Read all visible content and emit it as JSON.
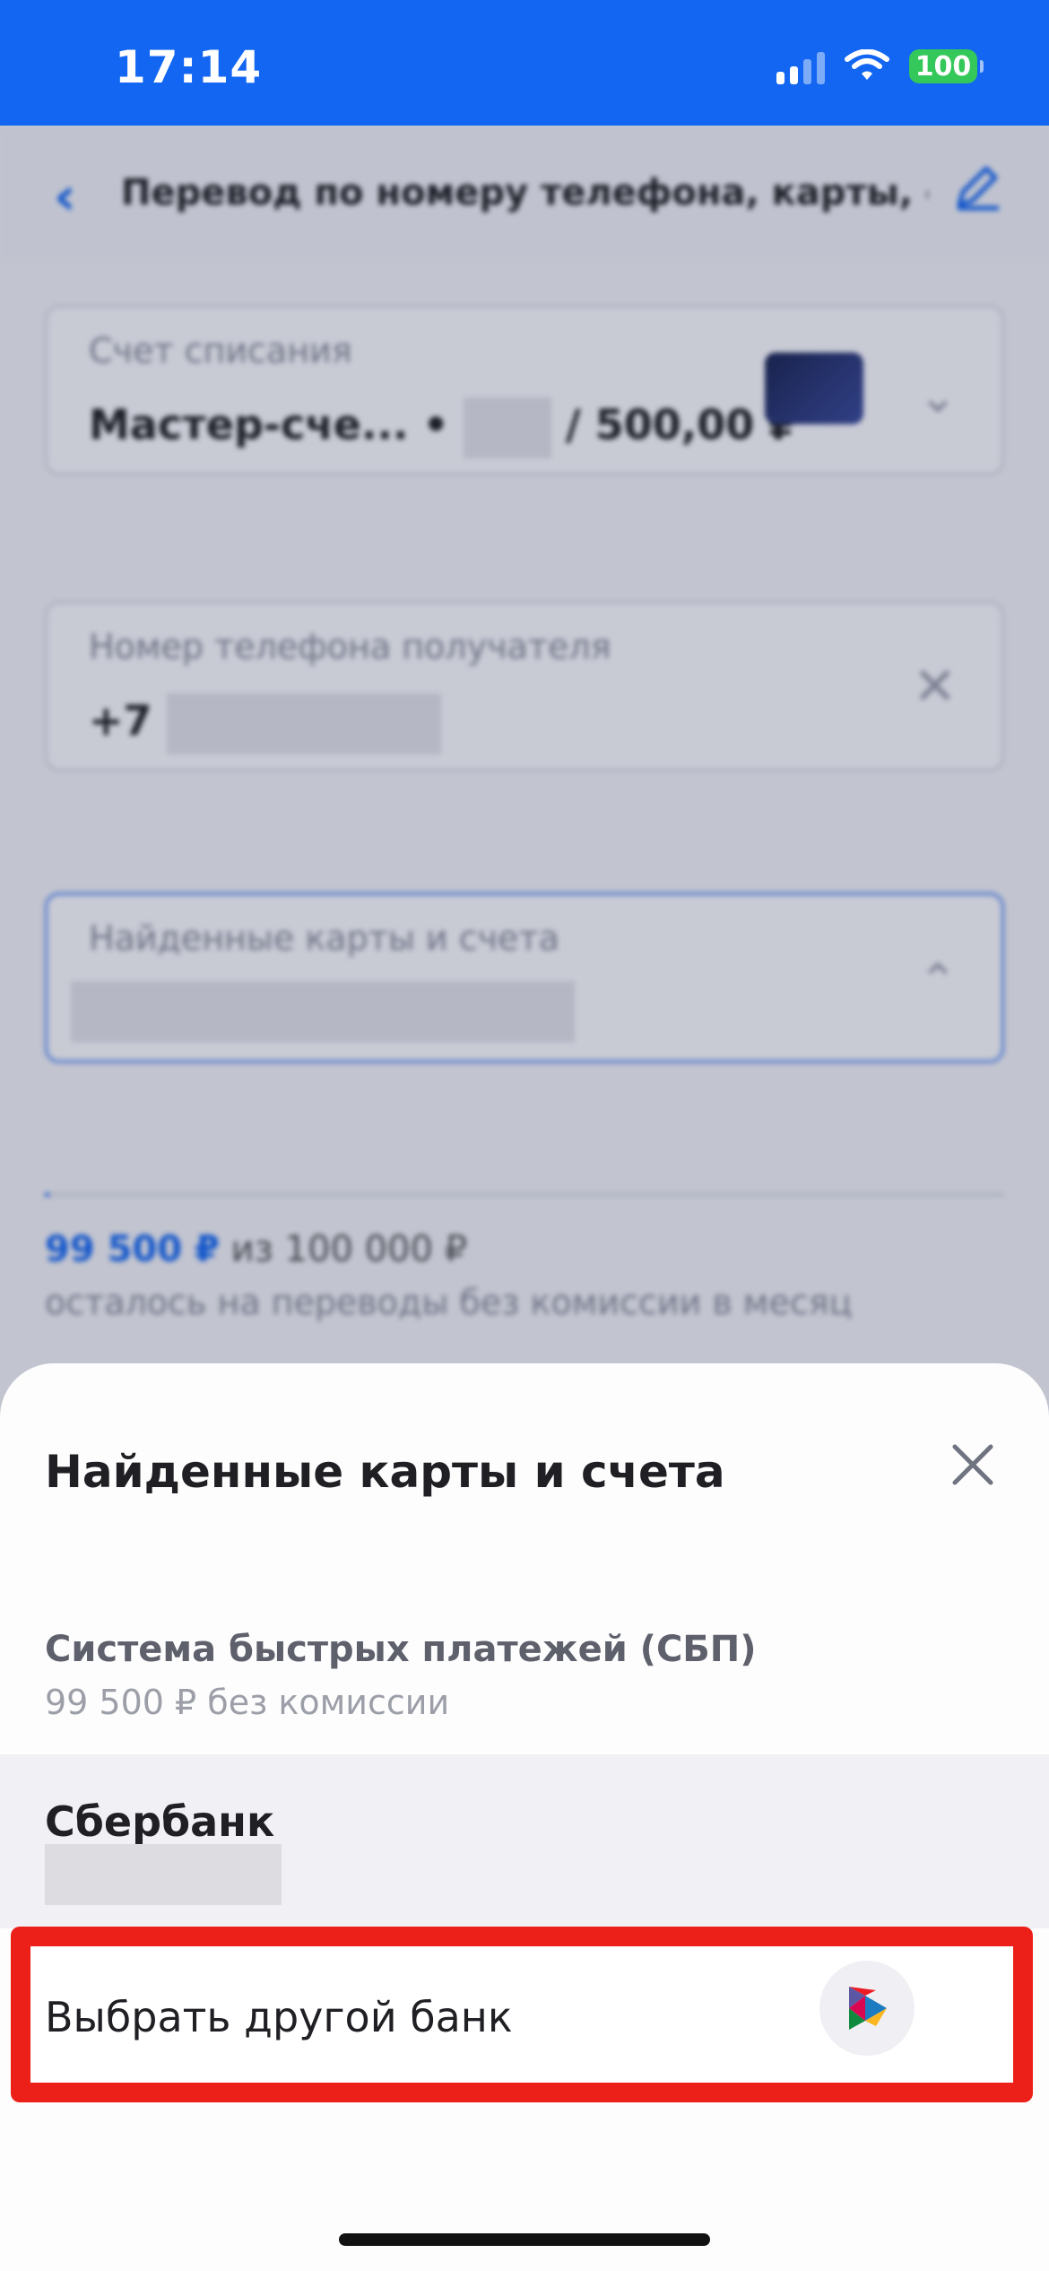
{
  "status_bar": {
    "time": "17:14",
    "battery": "100"
  },
  "background": {
    "header_title": "Перевод по номеру телефона, карты, счета",
    "account_field": {
      "label": "Счет списания",
      "value_prefix": "Мастер-сче... •",
      "value_suffix": "/ 500,00 ₽"
    },
    "phone_field": {
      "label": "Номер телефона получателя",
      "value_prefix": "+7"
    },
    "found_field": {
      "label": "Найденные карты и счета"
    },
    "limit": {
      "amount": "99 500 ₽",
      "of_total": "из 100 000 ₽",
      "note": "осталось на переводы без комиссии в месяц",
      "used_fraction": 0.005
    }
  },
  "sheet": {
    "title": "Найденные карты и счета",
    "sbp_title": "Система быстрых платежей (СБП)",
    "sbp_subtitle": "99 500 ₽ без комиссии",
    "bank_name": "Сбербанк",
    "other_bank_label": "Выбрать другой банк"
  },
  "colors": {
    "brand_blue": "#1266f1",
    "highlight_red": "#ec2018",
    "battery_green": "#34c759"
  },
  "icons": [
    "back-chevron-icon",
    "edit-pencil-icon",
    "chevron-down-icon",
    "clear-icon",
    "chevron-up-icon",
    "close-icon",
    "sbp-logo-icon"
  ]
}
